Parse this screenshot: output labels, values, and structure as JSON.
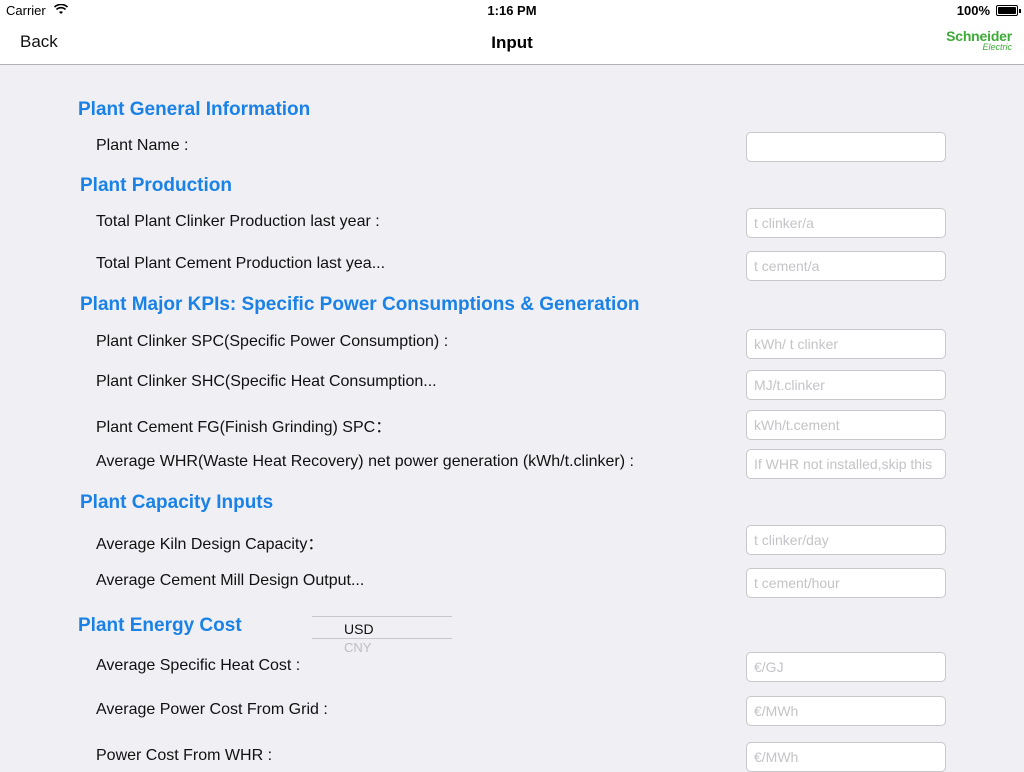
{
  "status": {
    "carrier": "Carrier",
    "time": "1:16 PM",
    "battery": "100%"
  },
  "nav": {
    "back_label": "Back",
    "title": "Input",
    "logo_line1": "Schneider",
    "logo_line2": "Electric"
  },
  "sections": {
    "general": {
      "title": "Plant General Information",
      "plant_name_label": "Plant Name :",
      "plant_name_value": ""
    },
    "production": {
      "title": "Plant Production",
      "clinker_label": "Total Plant Clinker Production last year :",
      "clinker_placeholder": "t clinker/a",
      "cement_label": "Total Plant Cement  Production last yea...",
      "cement_placeholder": "t cement/a"
    },
    "kpis": {
      "title": "Plant Major KPIs: Specific Power Consumptions & Generation",
      "spc_label": "Plant Clinker SPC(Specific Power Consumption) :",
      "spc_placeholder": "kWh/ t clinker",
      "shc_label": "Plant Clinker SHC(Specific Heat Consumption...",
      "shc_placeholder": "MJ/t.clinker",
      "fg_label": "Plant Cement FG(Finish Grinding) SPC：",
      "fg_placeholder": "kWh/t.cement",
      "whr_label": "Average WHR(Waste Heat Recovery) net power generation (kWh/t.clinker) :",
      "whr_placeholder": "If WHR not installed,skip this"
    },
    "capacity": {
      "title": "Plant Capacity Inputs",
      "kiln_label": "Average Kiln Design Capacity：",
      "kiln_placeholder": "t clinker/day",
      "mill_label": "Average Cement Mill Design Output...",
      "mill_placeholder": "t cement/hour"
    },
    "energy": {
      "title": "Plant Energy Cost",
      "currency_options": [
        "USD",
        "CNY"
      ],
      "heat_label": "Average Specific Heat Cost :",
      "heat_placeholder": "€/GJ",
      "grid_label": "Average Power Cost From Grid :",
      "grid_placeholder": "€/MWh",
      "whr_cost_label": "Power Cost From WHR :",
      "whr_cost_placeholder": "€/MWh"
    }
  }
}
